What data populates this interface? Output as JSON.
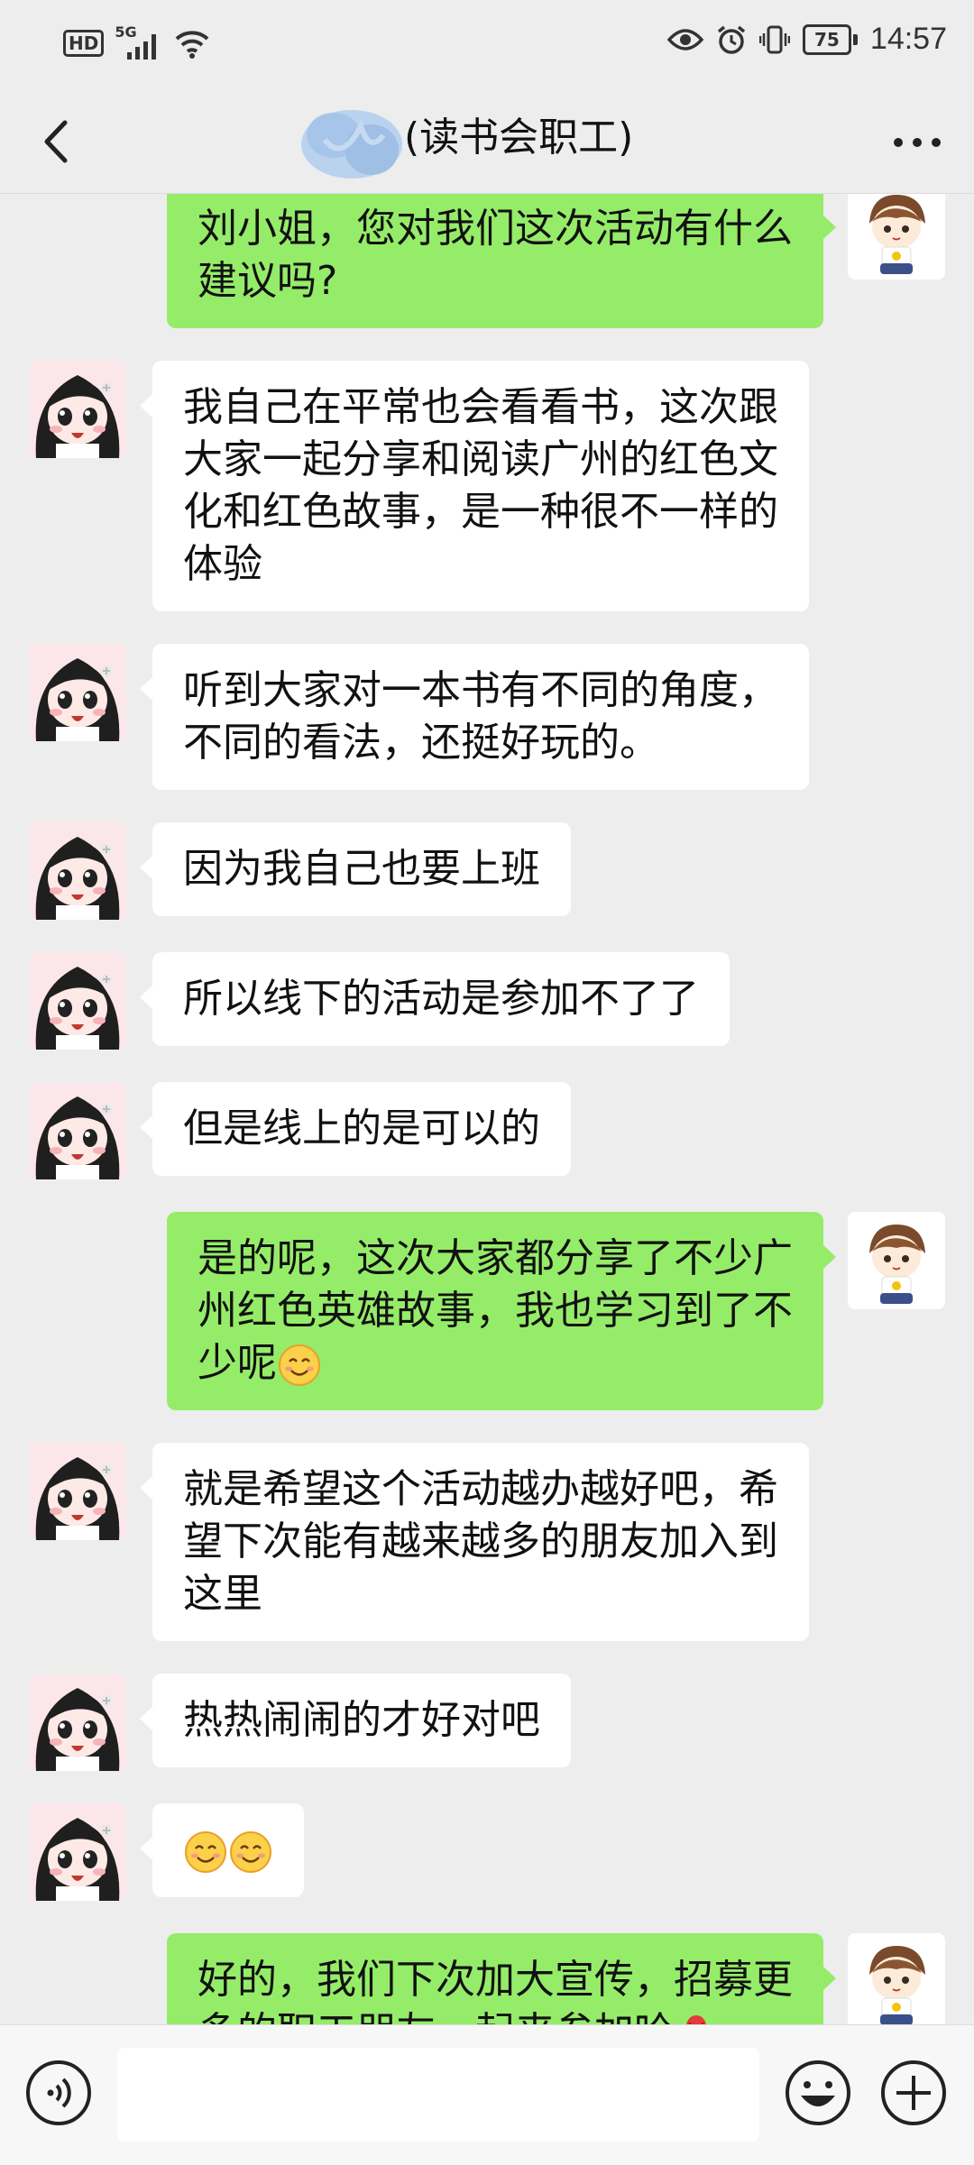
{
  "status_bar": {
    "hd_label": "HD",
    "network_label": "5G",
    "battery_level": "75",
    "time": "14:57"
  },
  "header": {
    "title": "(读书会职工)"
  },
  "messages": [
    {
      "side": "right",
      "text": "刘小姐，您对我们这次活动有什么\n建议吗?"
    },
    {
      "side": "left",
      "text": "我自己在平常也会看看书，这次跟\n大家一起分享和阅读广州的红色文\n化和红色故事，是一种很不一样的\n体验"
    },
    {
      "side": "left",
      "text": "听到大家对一本书有不同的角度，\n不同的看法，还挺好玩的。"
    },
    {
      "side": "left",
      "text": "因为我自己也要上班"
    },
    {
      "side": "left",
      "text": "所以线下的活动是参加不了了"
    },
    {
      "side": "left",
      "text": "但是线上的是可以的"
    },
    {
      "side": "right",
      "text": "是的呢，这次大家都分享了不少广\n州红色英雄故事，我也学习到了不\n少呢",
      "emoji": [
        "smile"
      ]
    },
    {
      "side": "left",
      "text": "就是希望这个活动越办越好吧，希\n望下次能有越来越多的朋友加入到\n这里"
    },
    {
      "side": "left",
      "text": "热热闹闹的才好对吧"
    },
    {
      "side": "left",
      "text": "",
      "emoji": [
        "smile",
        "smile"
      ]
    },
    {
      "side": "right",
      "text": "好的，我们下次加大宣传，招募更\n多的职工朋友一起来参加哈",
      "emoji": [
        "rose"
      ]
    }
  ],
  "input": {
    "value": "",
    "placeholder": ""
  },
  "icons": {
    "back": "back-arrow-icon",
    "more": "more-dots-icon",
    "voice": "voice-icon",
    "emoji": "emoji-face-icon",
    "plus": "plus-icon"
  },
  "colors": {
    "background": "#ededed",
    "sent_bubble": "#95ec69",
    "received_bubble": "#ffffff"
  }
}
